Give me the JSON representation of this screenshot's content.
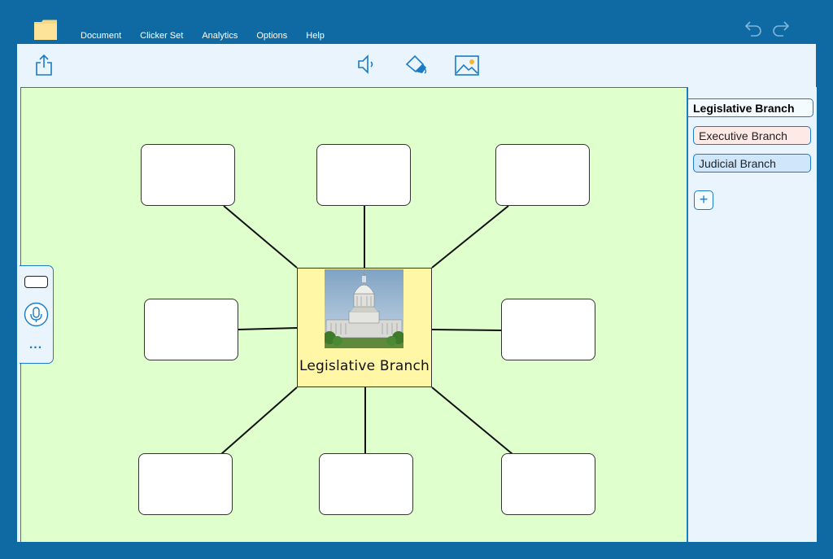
{
  "menu": {
    "items": [
      "Document",
      "Clicker Set",
      "Analytics",
      "Options",
      "Help"
    ]
  },
  "toolbar": {
    "icons": [
      "share-icon",
      "speaker-icon",
      "fill-bucket-icon",
      "image-icon"
    ]
  },
  "mindmap": {
    "center_label": "Legislative Branch",
    "center_image": "us-capitol-building",
    "box_count": 8
  },
  "sidebar": {
    "tabs": [
      {
        "label": "Legislative Branch",
        "active": true
      },
      {
        "label": "Executive Branch",
        "active": false
      },
      {
        "label": "Judicial Branch",
        "active": false
      }
    ],
    "add_label": "+"
  },
  "leftpanel": {
    "more_label": "..."
  },
  "colors": {
    "frame": "#0f6aa3",
    "canvas": "#dfffcc",
    "center_fill": "#fff7a6",
    "accent": "#1a7bc6"
  }
}
